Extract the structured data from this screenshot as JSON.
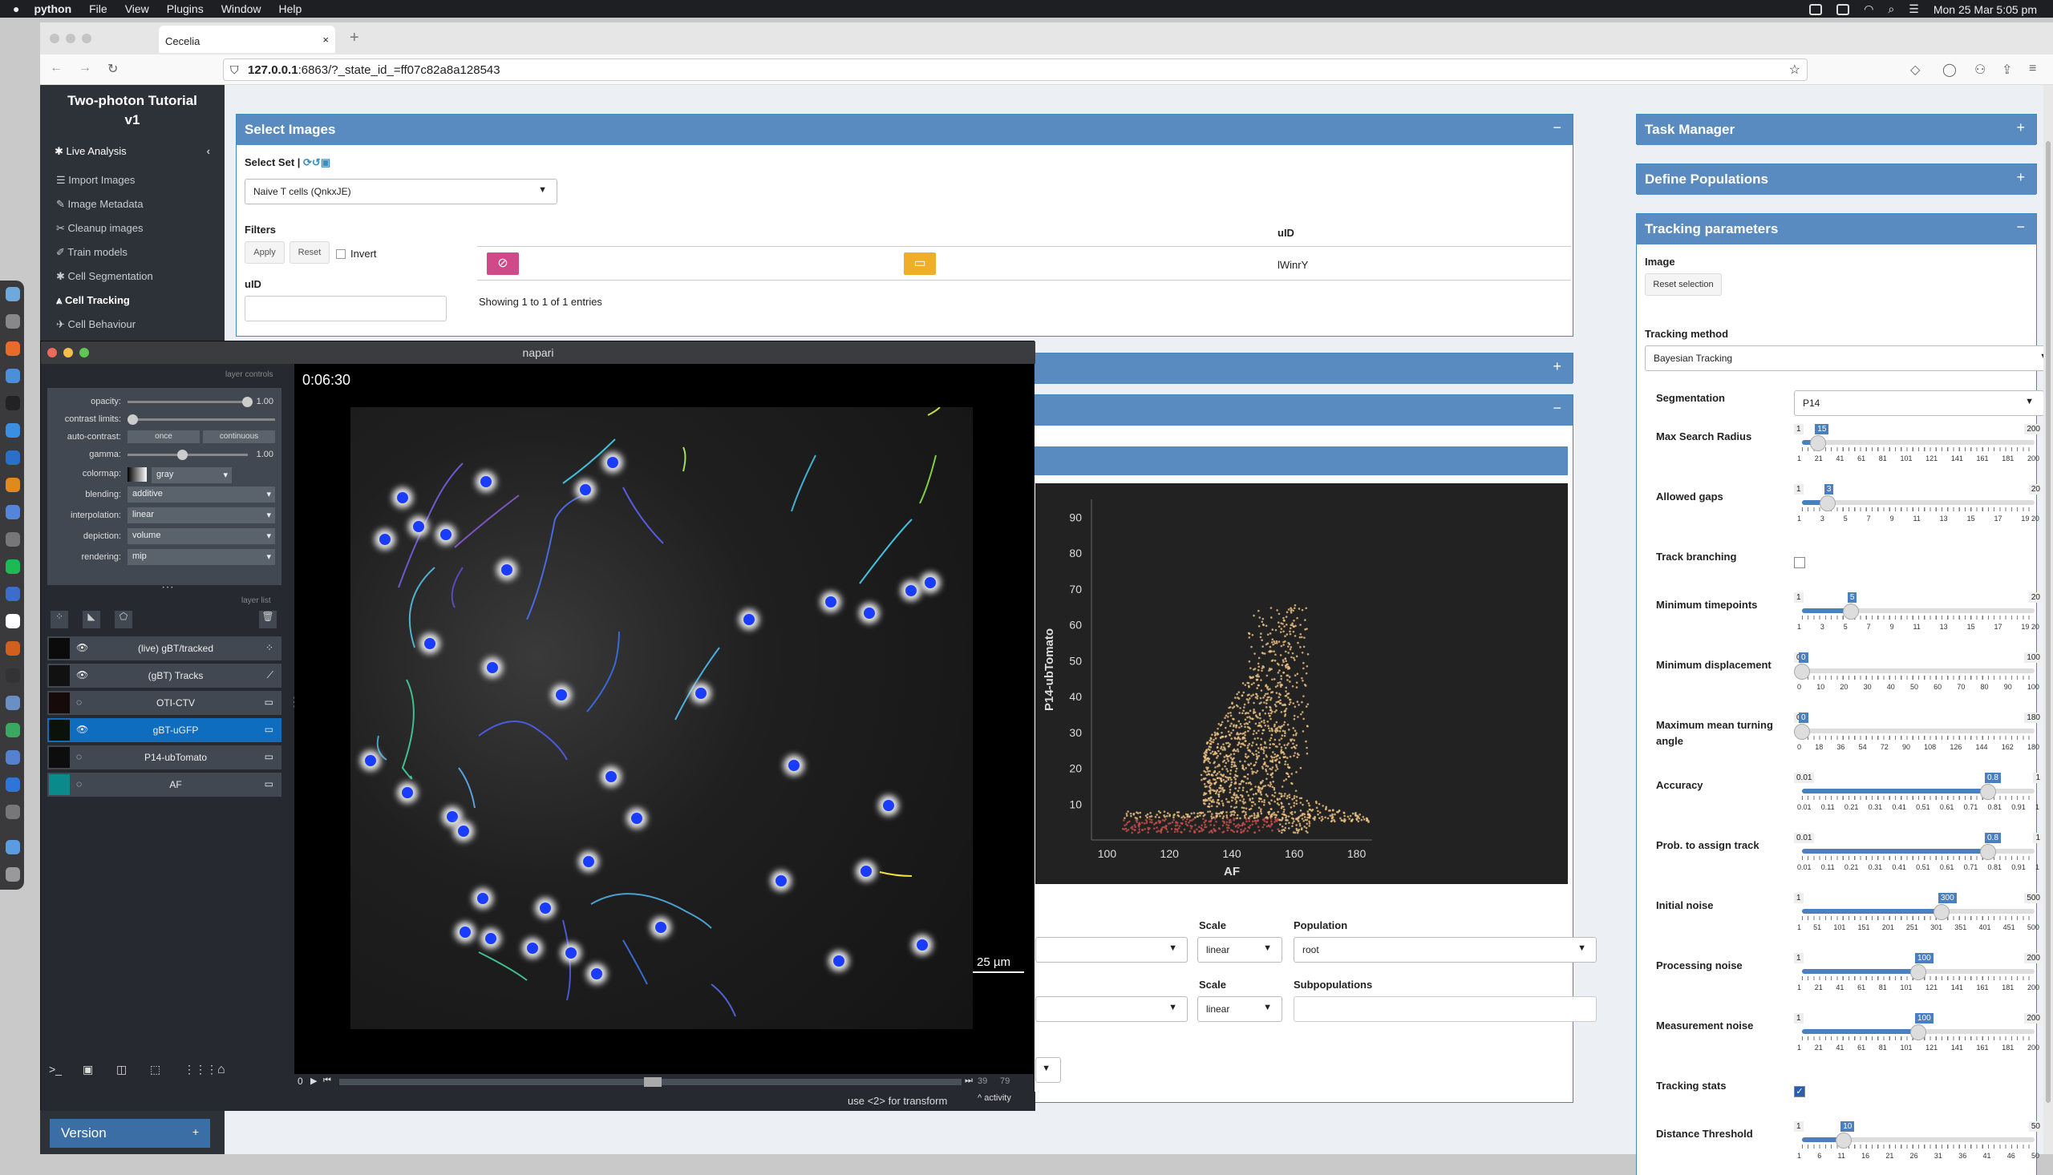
{
  "menubar": {
    "app": "python",
    "items": [
      "File",
      "View",
      "Plugins",
      "Window",
      "Help"
    ],
    "clock": "Mon 25 Mar  5:05 pm"
  },
  "browser": {
    "tab_title": "Cecelia",
    "url_host": "127.0.0.1",
    "url_rest": ":6863/?_state_id_=ff07c82a8a128543"
  },
  "sidebar": {
    "title_line1": "Two-photon Tutorial",
    "title_line2": "v1",
    "section": "Live Analysis",
    "items": [
      "Import Images",
      "Image Metadata",
      "Cleanup images",
      "Train models",
      "Cell Segmentation",
      "Cell Tracking",
      "Cell Behaviour"
    ],
    "active_index": 5,
    "version_label": "Version"
  },
  "select_images": {
    "title": "Select Images",
    "select_set_label": "Select Set",
    "set_value": "Naive T cells (QnkxJE)",
    "filters_label": "Filters",
    "apply": "Apply",
    "reset": "Reset",
    "invert": "Invert",
    "uid_label": "uID",
    "table_header": "uID",
    "table_row_uid": "lWinrY",
    "showing": "Showing 1 to 1 of 1 entries"
  },
  "population_panel": {
    "scale_label": "Scale",
    "scale_value": "linear",
    "population_label": "Population",
    "population_value": "root",
    "scale2_label": "Scale",
    "scale2_value": "linear",
    "subpop_label": "Subpopulations"
  },
  "right": {
    "task_manager": "Task Manager",
    "define_populations": "Define Populations",
    "tracking_params": "Tracking parameters",
    "image_label": "Image",
    "reset_selection": "Reset selection",
    "tracking_method_label": "Tracking method",
    "tracking_method_value": "Bayesian Tracking",
    "segmentation_label": "Segmentation",
    "segmentation_value": "P14",
    "params": [
      {
        "label": "Max Search Radius",
        "min": "1",
        "max": "200",
        "value": "15",
        "frac": 0.07,
        "ticks": [
          "1",
          "21",
          "41",
          "61",
          "81",
          "101",
          "121",
          "141",
          "161",
          "181",
          "200"
        ]
      },
      {
        "label": "Allowed gaps",
        "min": "1",
        "max": "20",
        "value": "3",
        "frac": 0.11,
        "ticks": [
          "1",
          "3",
          "5",
          "7",
          "9",
          "11",
          "13",
          "15",
          "17",
          "19 20"
        ]
      },
      {
        "label": "Track branching",
        "type": "checkbox",
        "checked": false
      },
      {
        "label": "Minimum timepoints",
        "min": "1",
        "max": "20",
        "value": "5",
        "frac": 0.21,
        "ticks": [
          "1",
          "3",
          "5",
          "7",
          "9",
          "11",
          "13",
          "15",
          "17",
          "19 20"
        ]
      },
      {
        "label": "Minimum displacement",
        "min": "0",
        "max": "100",
        "value": "0",
        "frac": 0.0,
        "ticks": [
          "0",
          "10",
          "20",
          "30",
          "40",
          "50",
          "60",
          "70",
          "80",
          "90",
          "100"
        ]
      },
      {
        "label": "Maximum mean turning angle",
        "min": "0",
        "max": "180",
        "value": "0",
        "frac": 0.0,
        "ticks": [
          "0",
          "18",
          "36",
          "54",
          "72",
          "90",
          "108",
          "126",
          "144",
          "162",
          "180"
        ]
      },
      {
        "label": "Accuracy",
        "min": "0.01",
        "max": "1",
        "value": "0.8",
        "frac": 0.8,
        "ticks": [
          "0.01",
          "0.11",
          "0.21",
          "0.31",
          "0.41",
          "0.51",
          "0.61",
          "0.71",
          "0.81",
          "0.91",
          "1"
        ]
      },
      {
        "label": "Prob. to assign track",
        "min": "0.01",
        "max": "1",
        "value": "0.8",
        "frac": 0.8,
        "ticks": [
          "0.01",
          "0.11",
          "0.21",
          "0.31",
          "0.41",
          "0.51",
          "0.61",
          "0.71",
          "0.81",
          "0.91",
          "1"
        ]
      },
      {
        "label": "Initial noise",
        "min": "1",
        "max": "500",
        "value": "300",
        "frac": 0.6,
        "ticks": [
          "1",
          "51",
          "101",
          "151",
          "201",
          "251",
          "301",
          "351",
          "401",
          "451",
          "500"
        ]
      },
      {
        "label": "Processing noise",
        "min": "1",
        "max": "200",
        "value": "100",
        "frac": 0.5,
        "ticks": [
          "1",
          "21",
          "41",
          "61",
          "81",
          "101",
          "121",
          "141",
          "161",
          "181",
          "200"
        ]
      },
      {
        "label": "Measurement noise",
        "min": "1",
        "max": "200",
        "value": "100",
        "frac": 0.5,
        "ticks": [
          "1",
          "21",
          "41",
          "61",
          "81",
          "101",
          "121",
          "141",
          "161",
          "181",
          "200"
        ]
      },
      {
        "label": "Tracking stats",
        "type": "checkbox",
        "checked": true
      },
      {
        "label": "Distance Threshold",
        "min": "1",
        "max": "50",
        "value": "10",
        "frac": 0.18,
        "ticks": [
          "1",
          "6",
          "11",
          "16",
          "21",
          "26",
          "31",
          "36",
          "41",
          "46",
          "50"
        ]
      }
    ]
  },
  "napari": {
    "title": "napari",
    "layer_controls": "layer controls",
    "layer_list": "layer list",
    "time": "0:06:30",
    "scale_bar": "25 µm",
    "frame": "0",
    "frame_a": "39",
    "frame_b": "79",
    "status": "use <2> for transform",
    "activity": "activity",
    "controls": {
      "opacity": "opacity:",
      "opacity_val": "1.00",
      "contrast": "contrast limits:",
      "autocontrast": "auto-contrast:",
      "once": "once",
      "continuous": "continuous",
      "gamma": "gamma:",
      "gamma_val": "1.00",
      "colormap": "colormap:",
      "colormap_val": "gray",
      "blending": "blending:",
      "blending_val": "additive",
      "interpolation": "interpolation:",
      "interpolation_val": "linear",
      "depiction": "depiction:",
      "depiction_val": "volume",
      "rendering": "rendering:",
      "rendering_val": "mip"
    },
    "layers": [
      "(live) gBT/tracked",
      "(gBT) Tracks",
      "OTI-CTV",
      "gBT-uGFP",
      "P14-ubTomato",
      "AF"
    ],
    "selected_layer": 3
  },
  "chart_data": {
    "type": "scatter",
    "xlabel": "AF",
    "ylabel": "P14-ubTomato",
    "xticks": [
      "100",
      "120",
      "140",
      "160",
      "180"
    ],
    "yticks": [
      "10",
      "20",
      "30",
      "40",
      "50",
      "60",
      "70",
      "80",
      "90"
    ],
    "xlim": [
      95,
      185
    ],
    "ylim": [
      0,
      95
    ],
    "grid": false,
    "background": "#222222",
    "point_color": "#f3c585",
    "dense_color": "#c8504a"
  }
}
